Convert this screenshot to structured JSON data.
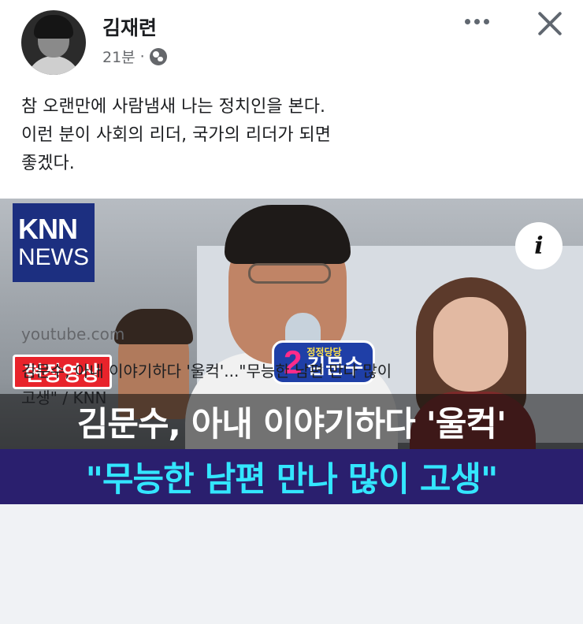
{
  "post": {
    "author": "김재련",
    "time": "21분",
    "separator": "·",
    "privacy_icon": "globe-icon",
    "text_lines": [
      "참 오랜만에 사람냄새 나는 정치인을 본다.",
      "이런 분이 사회의 리더, 국가의 리더가 되면",
      "좋겠다."
    ]
  },
  "header": {
    "more_icon": "more-dots-icon",
    "close_icon": "close-icon"
  },
  "link": {
    "thumbnail": {
      "logo_line1": "KNN",
      "logo_line2": "NEWS",
      "info_glyph": "i",
      "scene_tag": "현장영상",
      "badge_number": "2",
      "badge_slogan": "정정당당",
      "badge_name": "김문수",
      "headline_line1": "김문수, 아내 이야기하다 '울컥'",
      "headline_line2": "\"무능한 남편 만나 많이 고생\""
    },
    "domain": "youtube.com",
    "title_lines": [
      "김문수, 아내 이야기하다 '울컥'...\"무능한 남편 만나 많이",
      "고생\" / KNN"
    ]
  },
  "colors": {
    "text_primary": "#1c1e21",
    "text_secondary": "#65676b",
    "link_bg": "#f0f2f5",
    "knn_blue": "#1c2f80",
    "tag_red": "#e8232b",
    "headline_cyan": "#33e6ff"
  }
}
